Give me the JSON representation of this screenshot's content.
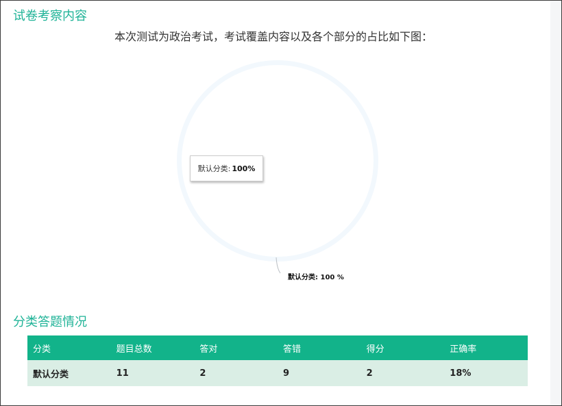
{
  "section_titles": {
    "exam_content": "试卷考察内容",
    "category_answers": "分类答题情况"
  },
  "intro_text": "本次测试为政治考试，考试覆盖内容以及各个部分的占比如下图：",
  "tooltip": {
    "label": "默认分类: ",
    "value": "100%"
  },
  "chart_data": {
    "type": "pie",
    "categories": [
      "默认分类"
    ],
    "values": [
      100
    ],
    "data_labels": [
      "默认分类: 100 %"
    ],
    "colors": [
      "#f2f8fd"
    ],
    "legend": "none"
  },
  "table": {
    "headers": [
      "分类",
      "题目总数",
      "答对",
      "答错",
      "得分",
      "正确率"
    ],
    "rows": [
      [
        "默认分类",
        "11",
        "2",
        "9",
        "2",
        "18%"
      ]
    ]
  },
  "colors": {
    "accent": "#1fb397",
    "table_header": "#12b38a",
    "table_row": "#daeee5"
  }
}
